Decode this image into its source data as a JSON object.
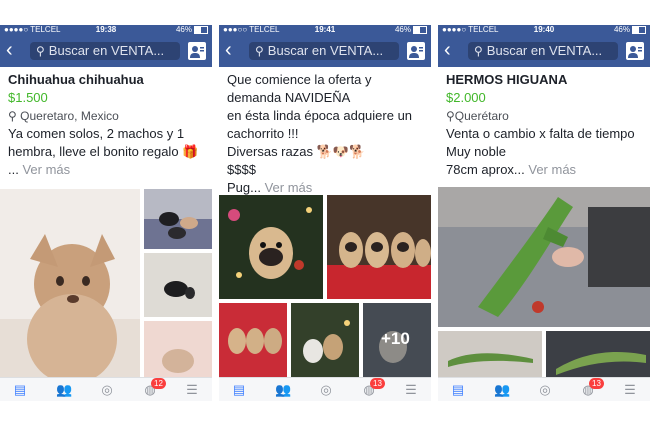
{
  "panels": [
    {
      "status": {
        "carrier": "●●●●○ TELCEL",
        "time": "19:38",
        "battery": "46%"
      },
      "search_placeholder": "Buscar en VENTA...",
      "title": "Chihuahua chihuahua",
      "price": "$1.500",
      "location": "Queretaro, Mexico",
      "desc": [
        "Ya comen solos, 2 machos y 1",
        "hembra, lleve el bonito regalo 🎁",
        "... "
      ],
      "more": "Ver más",
      "badge": "12"
    },
    {
      "status": {
        "carrier": "●●●○○ TELCEL",
        "time": "19:41",
        "battery": "46%"
      },
      "search_placeholder": "Buscar en VENTA...",
      "desc": [
        "Que comience la oferta y",
        "demanda NAVIDEÑA",
        "en ésta linda época adquiere un",
        "cachorrito !!!",
        "Diversas razas 🐕🐶🐕",
        "$$$$",
        "Pug... "
      ],
      "more": "Ver más",
      "plus_count": "+10",
      "badge": "13"
    },
    {
      "status": {
        "carrier": "●●●●○ TELCEL",
        "time": "19:40",
        "battery": "46%"
      },
      "search_placeholder": "Buscar en VENTA...",
      "title": "HERMOS HIGUANA",
      "price": "$2.000",
      "location": "Querétaro",
      "desc": [
        "Venta o cambio x falta de tiempo",
        "Muy noble",
        "78cm aprox... "
      ],
      "more": "Ver más",
      "badge": "13"
    }
  ],
  "colors": {
    "brand": "#3b5998",
    "price": "#42b72a",
    "badge": "#fa3e3e",
    "active_tab": "#4080ff"
  },
  "icons": [
    "back-arrow-icon",
    "search-icon",
    "friend-requests-icon",
    "news-feed-icon",
    "friends-icon",
    "messenger-icon",
    "globe-icon",
    "menu-icon"
  ]
}
